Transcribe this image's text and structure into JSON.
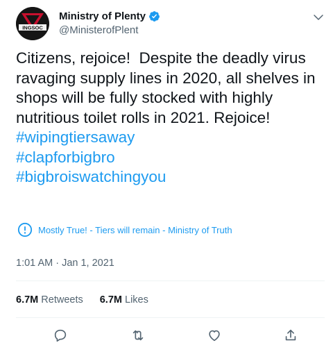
{
  "account": {
    "display_name": "Ministry of Plenty",
    "handle": "@MinisterofPlent",
    "avatar_text": "INGSOC",
    "verified": true
  },
  "tweet": {
    "text": "Citizens, rejoice!  Despite the deadly virus ravaging supply lines in 2020, all shelves in shops will be fully stocked with highly nutritious toilet rolls in 2021. Rejoice!",
    "hashtags": [
      "#wipingtiersaway",
      "#clapforbigbro",
      "#bigbroiswatchingyou"
    ]
  },
  "notice": {
    "text": "Mostly True! - Tiers will remain - Ministry of Truth",
    "icon": "exclamation-circle-icon"
  },
  "meta": {
    "timestamp": "1:01 AM · Jan 1, 2021"
  },
  "stats": {
    "retweets_count": "6.7M",
    "retweets_label": "Retweets",
    "likes_count": "6.7M",
    "likes_label": "Likes"
  },
  "actions": [
    "reply-icon",
    "retweet-icon",
    "like-icon",
    "share-icon"
  ],
  "colors": {
    "link": "#1d9bf0",
    "secondary_text": "#536471",
    "primary_text": "#0f1419",
    "divider": "#eff3f4"
  }
}
